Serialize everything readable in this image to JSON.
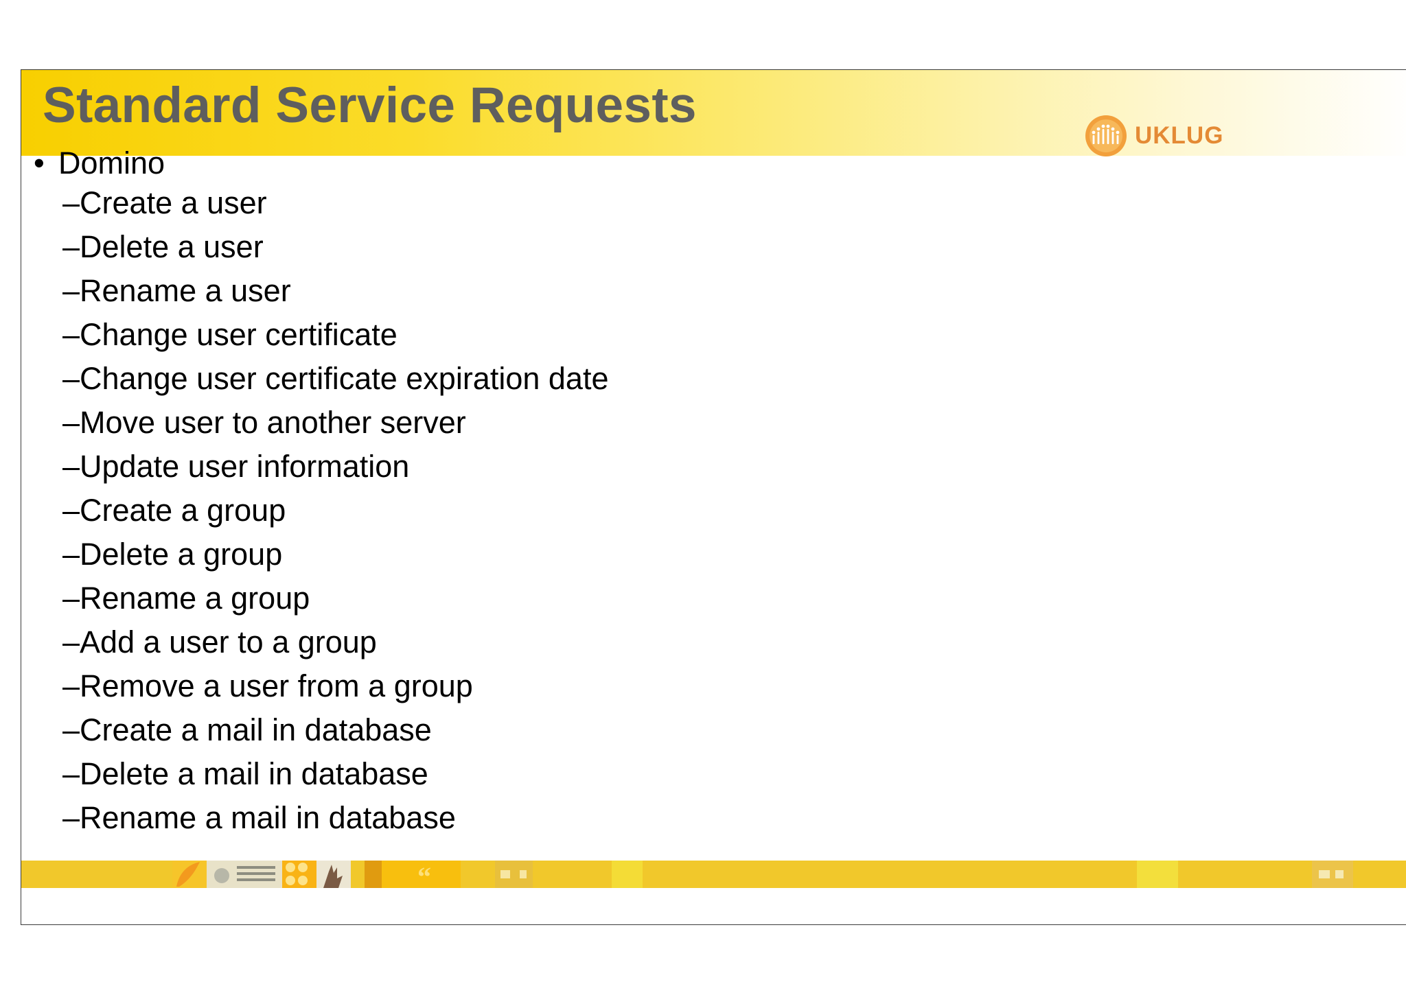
{
  "slide": {
    "title": "Standard Service Requests",
    "logo": {
      "text": "UKLUG",
      "icon": "uklug-logo-icon"
    },
    "section": {
      "bullet": "•",
      "label": "Domino",
      "items": [
        "–Create a user",
        "–Delete a user",
        "–Rename a user",
        "–Change user certificate",
        "–Change user certificate expiration date",
        "–Move user to another server",
        "–Update user information",
        "–Create a group",
        "–Delete a group",
        "–Rename a group",
        "–Add a user to a group",
        "–Remove a user from a group",
        "–Create a mail in database",
        "–Delete a mail in database",
        "–Rename a mail in database"
      ]
    }
  },
  "colors": {
    "title_band": "#f8cf00",
    "title_text": "#5e5e5e",
    "logo_text": "#e48a35",
    "footer_band": "#f1c82b"
  }
}
